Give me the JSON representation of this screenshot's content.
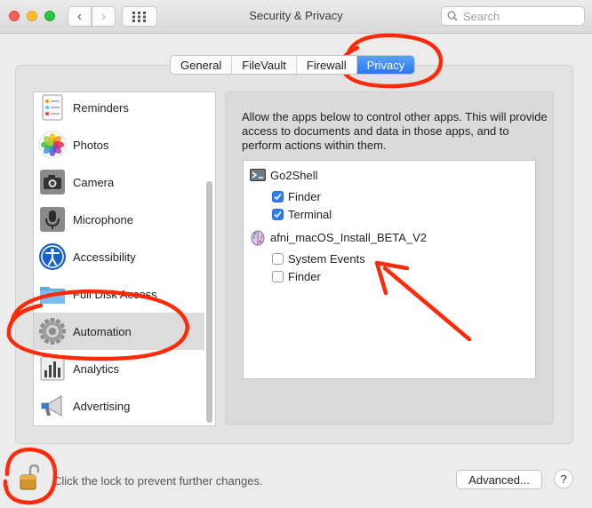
{
  "window": {
    "title": "Security & Privacy",
    "nav_back": "‹",
    "nav_forward": "›"
  },
  "search": {
    "placeholder": "Search",
    "value": ""
  },
  "tabs": [
    {
      "label": "General",
      "active": false
    },
    {
      "label": "FileVault",
      "active": false
    },
    {
      "label": "Firewall",
      "active": false
    },
    {
      "label": "Privacy",
      "active": true
    }
  ],
  "sidebar": {
    "items": [
      {
        "label": "Reminders",
        "icon": "reminders-icon",
        "selected": false
      },
      {
        "label": "Photos",
        "icon": "photos-icon",
        "selected": false
      },
      {
        "label": "Camera",
        "icon": "camera-icon",
        "selected": false
      },
      {
        "label": "Microphone",
        "icon": "microphone-icon",
        "selected": false
      },
      {
        "label": "Accessibility",
        "icon": "accessibility-icon",
        "selected": false
      },
      {
        "label": "Full Disk Access",
        "icon": "folder-icon",
        "selected": false
      },
      {
        "label": "Automation",
        "icon": "gear-icon",
        "selected": true
      },
      {
        "label": "Analytics",
        "icon": "analytics-icon",
        "selected": false
      },
      {
        "label": "Advertising",
        "icon": "megaphone-icon",
        "selected": false
      }
    ]
  },
  "main": {
    "description": "Allow the apps below to control other apps. This will provide access to documents and data in those apps, and to perform actions within them.",
    "apps": [
      {
        "name": "Go2Shell",
        "icon": "terminal-app-icon",
        "targets": [
          {
            "label": "Finder",
            "checked": true
          },
          {
            "label": "Terminal",
            "checked": true
          }
        ]
      },
      {
        "name": "afni_macOS_Install_BETA_V2",
        "icon": "brain-app-icon",
        "targets": [
          {
            "label": "System Events",
            "checked": false
          },
          {
            "label": "Finder",
            "checked": false
          }
        ]
      }
    ]
  },
  "footer": {
    "lock_text": "Click the lock to prevent further changes.",
    "advanced_label": "Advanced...",
    "help_label": "?"
  },
  "colors": {
    "accent": "#2f7bf2",
    "annotation_red": "#ff2a0a"
  }
}
